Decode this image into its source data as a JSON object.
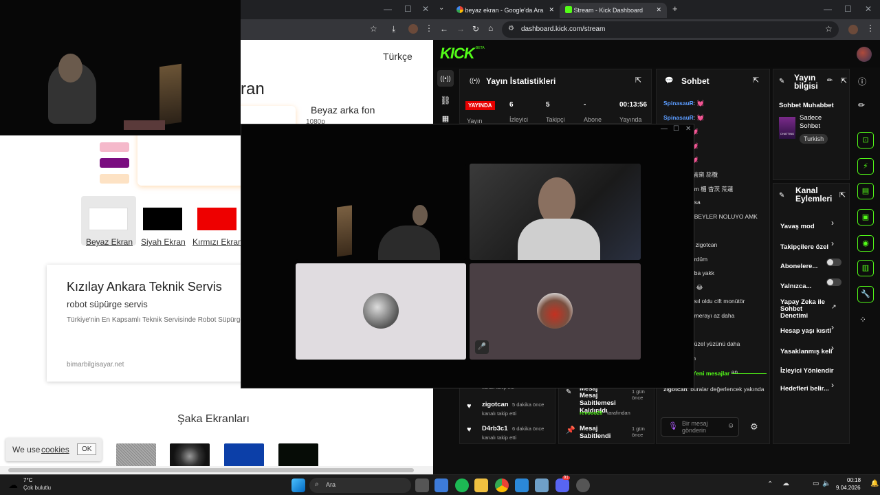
{
  "left_browser": {
    "language": "Türkçe",
    "heading_partial": "ran",
    "bg_title": "Beyaz arka fon",
    "bg_res_partial": "1080p",
    "swatches": [
      {
        "label": "Beyaz Ekran",
        "color": "#ffffff"
      },
      {
        "label": "Siyah Ekran",
        "color": "#000000"
      },
      {
        "label": "Kırmızı Ekran",
        "color": "#ee0000"
      }
    ],
    "mini_swatch_colors": [
      "#f5b9cb",
      "#7a0d80",
      "#fde2c4"
    ],
    "ad": {
      "title": "Kızılay Ankara Teknik Servis",
      "subtitle": "robot süpürge servis",
      "desc": "Türkiye'nin En Kapsamlı Teknik Servisinde Robot Süpürge",
      "domain": "bimarbilgisayar.net"
    },
    "section_title": "Şaka Ekranları",
    "cookie": {
      "text": "We use",
      "link": "cookies",
      "ok": "OK"
    }
  },
  "right_browser": {
    "tabs": [
      {
        "label": "beyaz ekran - Google'da Ara",
        "icon": "google-icon"
      },
      {
        "label": "Stream - Kick Dashboard",
        "icon": "kick-icon"
      }
    ],
    "url": "dashboard.kick.com/stream",
    "kick_logo": "KICK",
    "kick_beta": "BETA",
    "stats": {
      "title": "Yayın İstatistikleri",
      "live_badge": "YAYINDA",
      "live_label": "Yayın",
      "items": [
        {
          "value": "6",
          "label": "İzleyici"
        },
        {
          "value": "5",
          "label": "Takipçi"
        },
        {
          "value": "-",
          "label": "Abone"
        },
        {
          "value": "00:13:56",
          "label": "Yayında"
        }
      ]
    },
    "chat": {
      "title": "Sohbet",
      "lines": [
        {
          "user": "SpinasauR",
          "text": ": 💓"
        },
        {
          "user": "SpinasauR",
          "text": ": 💓"
        },
        {
          "user": "",
          "text": "💓"
        },
        {
          "user": "",
          "text": "💓"
        },
        {
          "user": "",
          "text": "💓"
        },
        {
          "user": "guanaa5r",
          "text": ": 偷窺 蕊欖"
        },
        {
          "user": "",
          "text": "om 楣 杳茨 荒蘧"
        },
        {
          "user": "",
          "text": ": sa"
        },
        {
          "user": "",
          "text": ": BEYLER NOLUYO AMK"
        },
        {
          "user": "",
          "text": "a"
        },
        {
          "user": "",
          "text": "s zigotcan"
        },
        {
          "user": "",
          "text": "ördüm"
        },
        {
          "user": "",
          "text": "aba yakk"
        },
        {
          "user": "",
          "text": "): 😂"
        },
        {
          "user": "",
          "text": "asıl oldu cift monütör"
        },
        {
          "user": "",
          "text": "amerayı az daha"
        },
        {
          "user": "",
          "text": ""
        },
        {
          "user": "",
          "text": "güzel yüzünü daha"
        },
        {
          "user": "",
          "text": "m"
        },
        {
          "user": "",
          "text": "c de dursun ekran"
        }
      ],
      "new_messages": "Yeni mesajlar",
      "last_user": "zigotcan",
      "last_text": ": buralar değerlencek yakında",
      "input_placeholder": "Bir mesaj gönderin"
    },
    "activity": [
      {
        "name": "",
        "time": "",
        "desc": "kanalı takip etti"
      },
      {
        "name": "zigotcan",
        "time": "5 dakika önce",
        "desc": "kanalı takip etti"
      },
      {
        "name": "D4rb3c1",
        "time": "6 dakika önce",
        "desc": "kanalı takip etti"
      }
    ],
    "mod_log": [
      {
        "title": "Mesaj Sabitlemesi Kaldırıldı",
        "time": "1 gün önce",
        "by_user": "revooo26",
        "by": "tarafından"
      },
      {
        "title": "Mesaj Sabitlendi",
        "time": "1 gün önce"
      }
    ],
    "mod_log_top": {
      "title": "Mesaj",
      "time": "1 gün önce"
    },
    "info": {
      "title": "Yayın bilgisi",
      "category": "Sohbet Muhabbet",
      "sub": "Sadece Sohbet",
      "tag": "Turkish",
      "thumb_text": "CHATTING"
    },
    "actions": {
      "title": "Kanal Eylemleri",
      "items": [
        {
          "label": "Yavaş mod",
          "control": "chevron"
        },
        {
          "label": "Takipçilere özel",
          "control": "chevron"
        },
        {
          "label": "Abonelere...",
          "control": "toggle"
        },
        {
          "label": "Yalnızca...",
          "control": "toggle"
        },
        {
          "label": "Yapay Zeka ile Sohbet Denetimi",
          "control": "external"
        },
        {
          "label": "Hesap yaşı kısıtl",
          "control": "chevron"
        },
        {
          "label": "Yasaklanmış keli",
          "control": "chevron"
        },
        {
          "label": "İzleyici Yönlendir",
          "control": "none"
        },
        {
          "label": "Hedefleri belir...",
          "control": "chevron"
        }
      ]
    }
  },
  "taskbar": {
    "weather_temp": "7°C",
    "weather_desc": "Çok bulutlu",
    "search": "Ara",
    "time": "00:18",
    "date": "9.04.2026",
    "discord_badge": "91"
  }
}
